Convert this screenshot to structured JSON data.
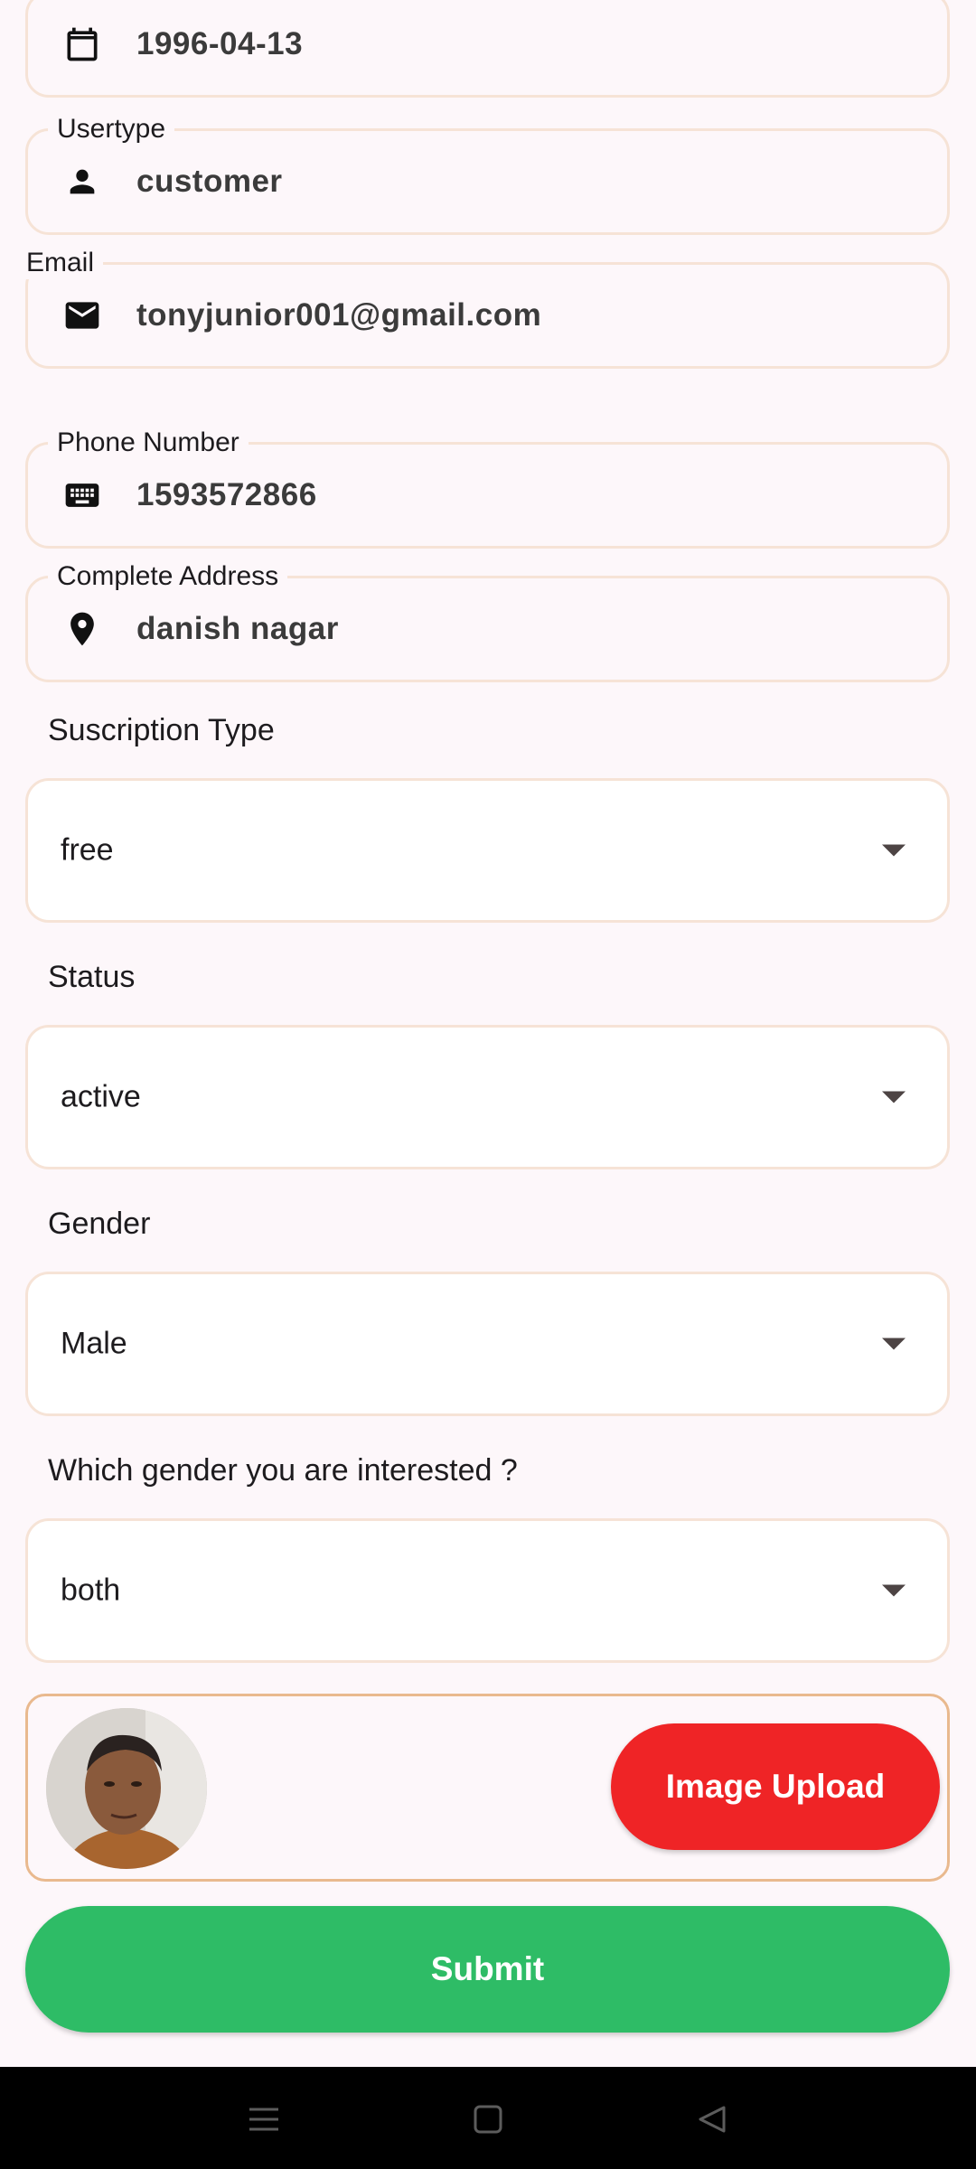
{
  "fields": {
    "dob": {
      "value": "1996-04-13",
      "icon": "calendar-icon"
    },
    "usertype": {
      "label": "Usertype",
      "value": "customer",
      "icon": "person-icon"
    },
    "email": {
      "label": "Email",
      "value": "tonyjunior001@gmail.com",
      "icon": "mail-icon"
    },
    "phone": {
      "label": "Phone Number",
      "value": "1593572866",
      "icon": "keyboard-icon"
    },
    "address": {
      "label": "Complete Address",
      "value": "danish nagar",
      "icon": "location-pin-icon"
    }
  },
  "dropdowns": {
    "subscription": {
      "label": "Suscription Type",
      "value": "free"
    },
    "status": {
      "label": "Status",
      "value": "active"
    },
    "gender": {
      "label": "Gender",
      "value": "Male"
    },
    "interest": {
      "label": "Which gender you are interested ?",
      "value": "both"
    }
  },
  "upload": {
    "button_label": "Image Upload"
  },
  "submit": {
    "label": "Submit"
  },
  "colors": {
    "upload_button": "#ef2426",
    "submit_button": "#2ebc66",
    "field_border": "#f6e3d6",
    "background": "#fdf7fa"
  },
  "navbar": {
    "icons": [
      "menu-icon",
      "home-square-icon",
      "back-triangle-icon"
    ]
  }
}
